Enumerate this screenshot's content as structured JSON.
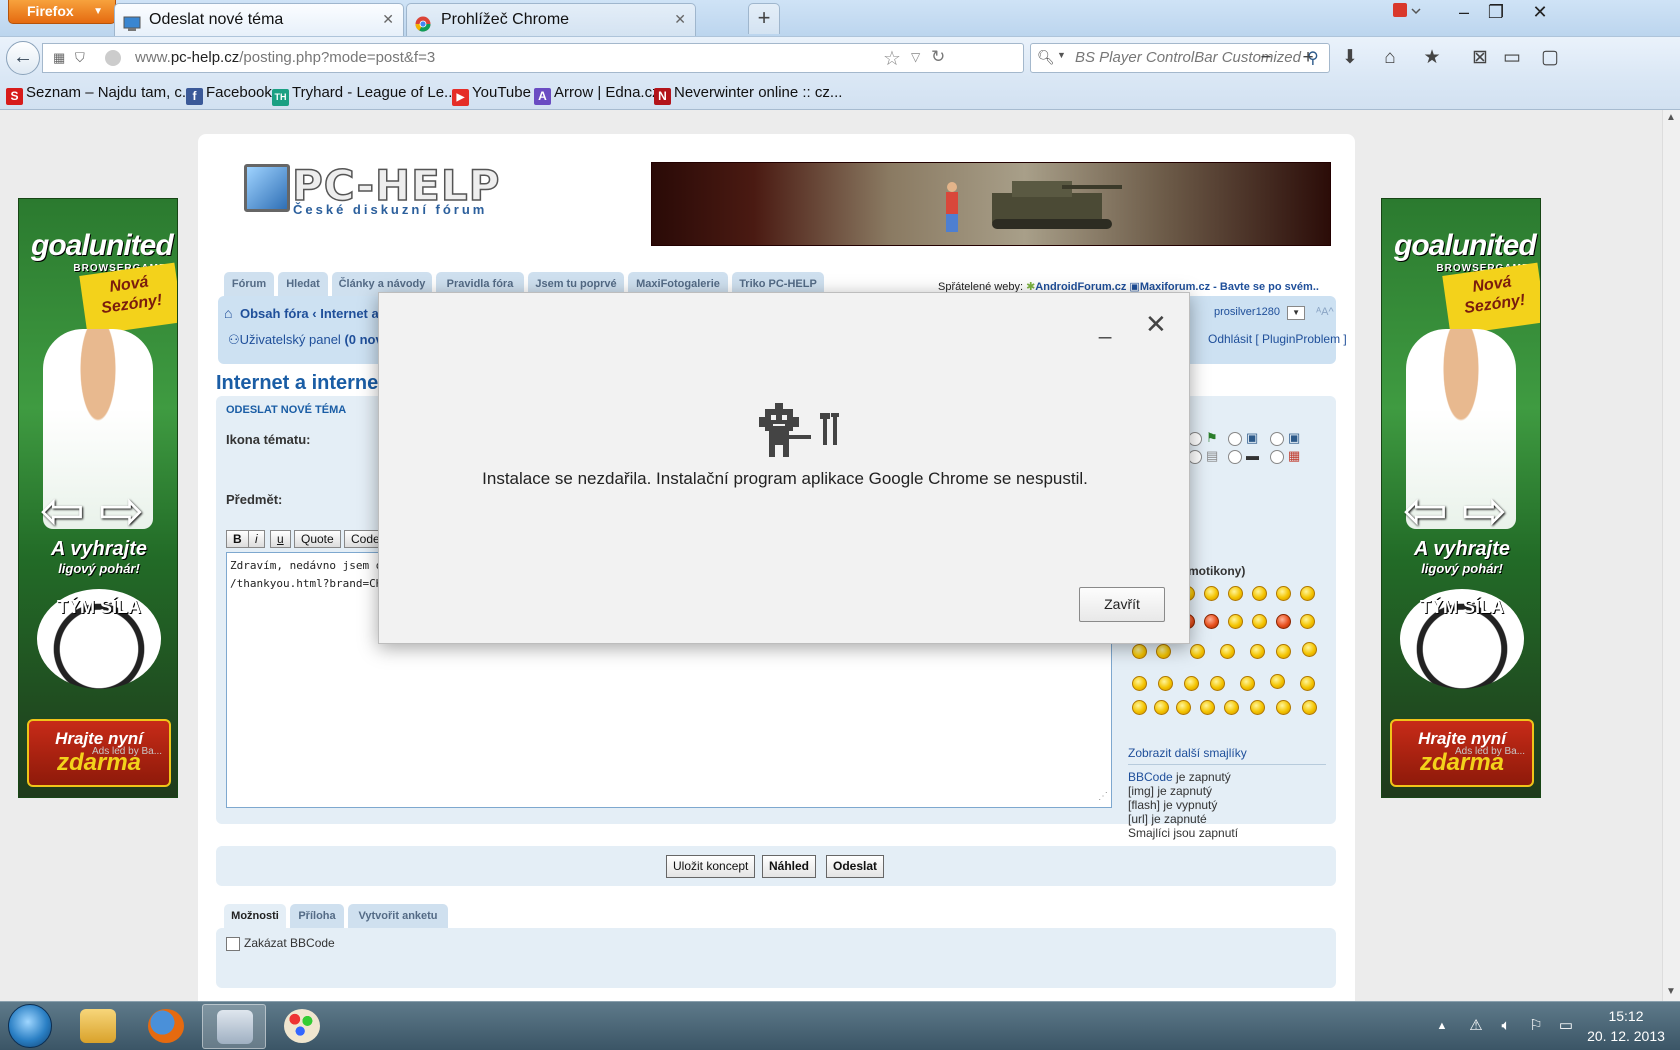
{
  "browser": {
    "menu_button": "Firefox",
    "tabs": [
      {
        "title": "Odeslat nové téma"
      },
      {
        "title": "Prohlížeč Chrome"
      }
    ],
    "new_tab": "+",
    "url_prefix": "www.",
    "url_domain": "pc-help.cz",
    "url_path": "/posting.php?mode=post&f=3",
    "search_placeholder": "BS Player ControlBar Customized W",
    "bookmarks": [
      {
        "label": "Seznam – Najdu tam, c...",
        "icon": "S",
        "color": "#d71b1b"
      },
      {
        "label": "Facebook",
        "icon": "f",
        "color": "#3b5998"
      },
      {
        "label": "Tryhard - League of Le...",
        "icon": "TH",
        "color": "#1aa083"
      },
      {
        "label": "YouTube",
        "icon": "▶",
        "color": "#e52d27"
      },
      {
        "label": "Arrow | Edna.cz",
        "icon": "A",
        "color": "#6a4cc2"
      },
      {
        "label": "Neverwinter online :: cz...",
        "icon": "N",
        "color": "#b3141a"
      }
    ]
  },
  "ads": {
    "brand": "goalunited",
    "brand_sub": "BROWSERGAME",
    "badge_1": "Nová",
    "badge_2": "Sezóny!",
    "win_1": "A vyhrajte",
    "win_2": "ligový pohár!",
    "team": "TÝM SÍLA",
    "cta_1": "Hrajte nyní",
    "cta_2": "zdarma",
    "note": "Ads led by Ba..."
  },
  "forum": {
    "logo_title": "PC-HELP",
    "logo_subtitle": "České diskuzní fórum",
    "nav_tabs": [
      "Fórum",
      "Hledat",
      "Články a návody",
      "Pravidla fóra",
      "Jsem tu poprvé",
      "MaxiFotogalerie",
      "Triko PC-HELP"
    ],
    "friends_label": "Spřátelené weby:",
    "friend_1": "AndroidForum.cz",
    "friend_2": "Maxiforum.cz - Bavte se po svém..",
    "breadcrumb_1": "Obsah fóra",
    "breadcrumb_2": "Internet a",
    "ucp": "Uživatelský panel",
    "ucp_count": "(0 novy",
    "username": "prosilver1280",
    "logout": "Odhlásit [ PluginProblem ]",
    "page_title": "Internet a interneto",
    "panel_title": "ODESLAT NOVÉ TÉMA",
    "icon_label": "Ikona tématu:",
    "subject_label": "Předmět:",
    "bb_buttons": [
      "B",
      "i",
      "u",
      "Quote",
      "Code"
    ],
    "message_line_1": "Zdravím, nedávno jsem od",
    "message_line_2": "/thankyou.html?brand=CHM",
    "smilies_title": "motikony)",
    "more_smilies": "Zobrazit další smajlíky",
    "bbcode_link": "BBCode",
    "bbcode_status": " je zapnutý",
    "img_status": "[img] je zapnutý",
    "flash_status": "[flash] je vypnutý",
    "url_status": "[url] je zapnuté",
    "smilies_status": "Smajlíci jsou zapnutí",
    "actions": [
      "Uložit koncept",
      "Náhled",
      "Odeslat"
    ],
    "option_tabs": [
      "Možnosti",
      "Příloha",
      "Vytvořit anketu"
    ],
    "option_1": "Zakázat BBCode"
  },
  "dialog": {
    "message": "Instalace se nezdařila. Instalační program aplikace Google Chrome se nespustil.",
    "close_button": "Zavřít"
  },
  "taskbar": {
    "time": "15:12",
    "date": "20. 12. 2013"
  },
  "colors": {
    "firefox_orange": "#e56a10",
    "forum_blue": "#1a5da5",
    "panel_bg": "#e4eef6"
  }
}
